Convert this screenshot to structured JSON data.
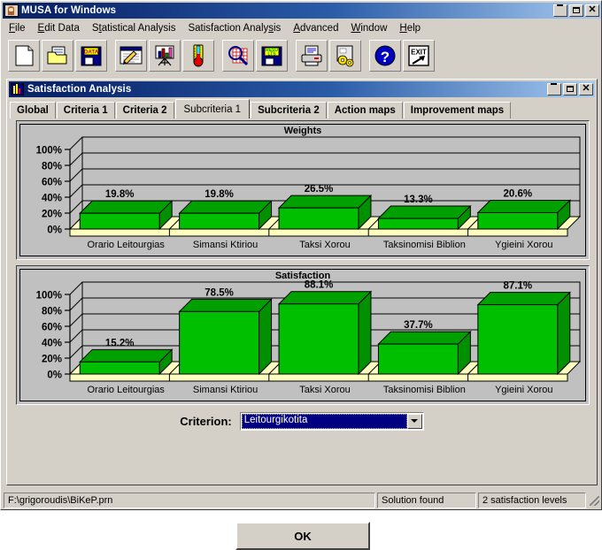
{
  "app": {
    "title": "MUSA for Windows",
    "icon": "person-portrait-icon",
    "window_buttons": {
      "minimize": "_",
      "maximize": "□",
      "close": "✕"
    }
  },
  "menubar": {
    "items": [
      {
        "label": "File",
        "mnemonic_index": 0
      },
      {
        "label": "Edit Data",
        "mnemonic_index": 0
      },
      {
        "label": "Statistical Analysis",
        "mnemonic_index": 1
      },
      {
        "label": "Satisfaction Analysis",
        "mnemonic_index": 15
      },
      {
        "label": "Advanced",
        "mnemonic_index": 0
      },
      {
        "label": "Window",
        "mnemonic_index": 0
      },
      {
        "label": "Help",
        "mnemonic_index": 0
      }
    ]
  },
  "toolbar": {
    "buttons": [
      {
        "icon": "new-document-icon",
        "tooltip": "New"
      },
      {
        "icon": "open-folder-icon",
        "tooltip": "Open"
      },
      {
        "icon": "save-data-disk-icon",
        "tooltip": "Save Data",
        "disk_text": "DATA"
      },
      {
        "icon": "edit-data-window-icon",
        "tooltip": "Edit Data"
      },
      {
        "icon": "chart-easel-icon",
        "tooltip": "Statistical Analysis"
      },
      {
        "icon": "thermometer-icon",
        "tooltip": "Satisfaction Analysis"
      },
      {
        "icon": "magnifier-grid-icon",
        "tooltip": "View Results"
      },
      {
        "icon": "save-results-disk-icon",
        "tooltip": "Save Results",
        "disk_text": "RESULTS"
      },
      {
        "icon": "printer-icon",
        "tooltip": "Print"
      },
      {
        "icon": "settings-gears-icon",
        "tooltip": "Options"
      },
      {
        "icon": "help-question-icon",
        "tooltip": "Help"
      },
      {
        "icon": "exit-arrow-icon",
        "tooltip": "Exit",
        "exit_text": "EXIT"
      }
    ]
  },
  "child_window": {
    "title": "Satisfaction Analysis",
    "icon": "bar-chart-icon",
    "window_buttons": {
      "minimize": "_",
      "maximize": "□",
      "close": "✕"
    },
    "tabs": [
      {
        "label": "Global",
        "active": false
      },
      {
        "label": "Criteria 1",
        "active": false
      },
      {
        "label": "Criteria 2",
        "active": false
      },
      {
        "label": "Subcriteria 1",
        "active": true
      },
      {
        "label": "Subcriteria 2",
        "active": false
      },
      {
        "label": "Action maps",
        "active": false
      },
      {
        "label": "Improvement maps",
        "active": false
      }
    ]
  },
  "criterion": {
    "label": "Criterion:",
    "selected": "Leitourgikotita",
    "options": [
      "Leitourgikotita"
    ]
  },
  "ok_button": {
    "label": "OK"
  },
  "statusbar": {
    "file": "F:\\grigoroudis\\BiKeP.prn",
    "solution": "Solution found",
    "levels": "2 satisfaction levels"
  },
  "colors": {
    "bar_face": "#00bf00",
    "bar_top": "#00a000",
    "bar_side": "#009000",
    "floor": "#ffffc0",
    "wall": "#c0c0c0",
    "titlebar_start": "#0a246a",
    "titlebar_end": "#a6caf0",
    "face": "#d4d0c8"
  },
  "chart_data": [
    {
      "type": "bar",
      "title": "Weights",
      "xlabel": "",
      "ylabel": "",
      "ylim": [
        0,
        100
      ],
      "yticks": [
        "0%",
        "20%",
        "40%",
        "60%",
        "80%",
        "100%"
      ],
      "grid": true,
      "legend": "none",
      "categories": [
        "Orario Leitourgias",
        "Simansi Ktiriou",
        "Taksi Xorou",
        "Taksinomisi Biblion",
        "Ygieini Xorou"
      ],
      "values": [
        19.8,
        19.8,
        26.5,
        13.3,
        20.6
      ],
      "data_labels": [
        "19.8%",
        "19.8%",
        "26.5%",
        "13.3%",
        "20.6%"
      ]
    },
    {
      "type": "bar",
      "title": "Satisfaction",
      "xlabel": "",
      "ylabel": "",
      "ylim": [
        0,
        100
      ],
      "yticks": [
        "0%",
        "20%",
        "40%",
        "60%",
        "80%",
        "100%"
      ],
      "grid": true,
      "legend": "none",
      "categories": [
        "Orario Leitourgias",
        "Simansi Ktiriou",
        "Taksi Xorou",
        "Taksinomisi Biblion",
        "Ygieini Xorou"
      ],
      "values": [
        15.2,
        78.5,
        88.1,
        37.7,
        87.1
      ],
      "data_labels": [
        "15.2%",
        "78.5%",
        "88.1%",
        "37.7%",
        "87.1%"
      ]
    }
  ]
}
